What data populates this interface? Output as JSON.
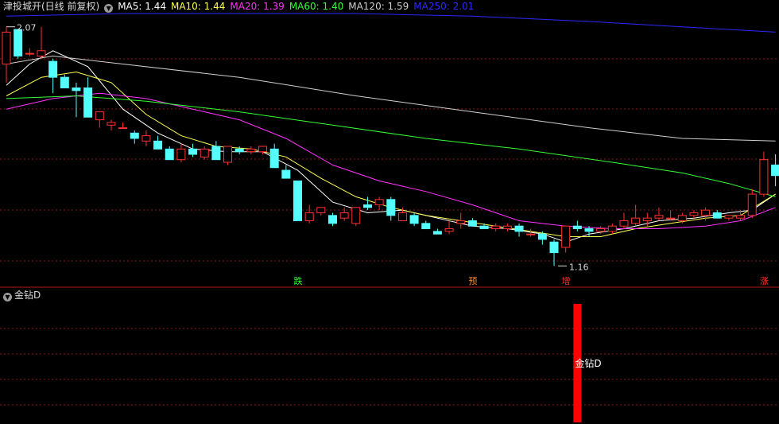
{
  "header": {
    "title": "津投城开(日线 前复权)",
    "ma_items": [
      {
        "label": "MA5: 1.44",
        "color": "#ffffff"
      },
      {
        "label": "MA10: 1.44",
        "color": "#ffff54"
      },
      {
        "label": "MA20: 1.39",
        "color": "#ff33ff"
      },
      {
        "label": "MA60: 1.40",
        "color": "#33ff33"
      },
      {
        "label": "MA120: 1.59",
        "color": "#cfcfcf"
      },
      {
        "label": "MA250: 2.01",
        "color": "#2a2aff"
      }
    ]
  },
  "sub_panel": {
    "title": "金钻D",
    "signal_label": "金钻D"
  },
  "markers": [
    {
      "text": "跌",
      "color": "#33ff33"
    },
    {
      "text": "预",
      "color": "#ff8a1e"
    },
    {
      "text": "增",
      "color": "#ff3030"
    },
    {
      "text": "涨",
      "color": "#ff3030"
    }
  ],
  "chart_data": {
    "type": "candlestick",
    "ylim": [
      1.09,
      2.12
    ],
    "annotations": {
      "high": "2.07",
      "low": "1.16"
    },
    "colors": {
      "up": "#ff3030",
      "down": "#54ffff",
      "grid": "#8a1c1c"
    },
    "candles": [
      [
        1.93,
        2.07,
        1.86,
        2.05
      ],
      [
        2.06,
        2.06,
        1.95,
        1.96
      ],
      [
        1.97,
        1.99,
        1.96,
        1.97
      ],
      [
        1.96,
        2.07,
        1.95,
        1.98
      ],
      [
        1.94,
        1.95,
        1.82,
        1.88
      ],
      [
        1.88,
        1.89,
        1.84,
        1.84
      ],
      [
        1.84,
        1.86,
        1.73,
        1.83
      ],
      [
        1.84,
        1.88,
        1.73,
        1.73
      ],
      [
        1.72,
        1.75,
        1.69,
        1.75
      ],
      [
        1.7,
        1.72,
        1.68,
        1.71
      ],
      [
        1.69,
        1.71,
        1.69,
        1.69
      ],
      [
        1.67,
        1.68,
        1.63,
        1.65
      ],
      [
        1.64,
        1.68,
        1.62,
        1.66
      ],
      [
        1.64,
        1.66,
        1.62,
        1.61
      ],
      [
        1.61,
        1.62,
        1.57,
        1.57
      ],
      [
        1.57,
        1.63,
        1.56,
        1.61
      ],
      [
        1.61,
        1.63,
        1.58,
        1.59
      ],
      [
        1.58,
        1.62,
        1.57,
        1.61
      ],
      [
        1.62,
        1.64,
        1.58,
        1.57
      ],
      [
        1.56,
        1.62,
        1.55,
        1.62
      ],
      [
        1.61,
        1.62,
        1.59,
        1.6
      ],
      [
        1.6,
        1.62,
        1.59,
        1.61
      ],
      [
        1.6,
        1.62,
        1.59,
        1.62
      ],
      [
        1.61,
        1.63,
        1.58,
        1.54
      ],
      [
        1.53,
        1.55,
        1.52,
        1.5
      ],
      [
        1.49,
        1.49,
        1.35,
        1.34
      ],
      [
        1.34,
        1.4,
        1.33,
        1.37
      ],
      [
        1.37,
        1.39,
        1.36,
        1.39
      ],
      [
        1.36,
        1.37,
        1.32,
        1.33
      ],
      [
        1.35,
        1.39,
        1.34,
        1.37
      ],
      [
        1.33,
        1.39,
        1.32,
        1.39
      ],
      [
        1.4,
        1.43,
        1.38,
        1.39
      ],
      [
        1.4,
        1.43,
        1.38,
        1.42
      ],
      [
        1.42,
        1.43,
        1.34,
        1.36
      ],
      [
        1.34,
        1.39,
        1.34,
        1.37
      ],
      [
        1.36,
        1.37,
        1.32,
        1.33
      ],
      [
        1.33,
        1.34,
        1.31,
        1.31
      ],
      [
        1.3,
        1.31,
        1.29,
        1.29
      ],
      [
        1.3,
        1.34,
        1.29,
        1.31
      ],
      [
        1.33,
        1.37,
        1.31,
        1.34
      ],
      [
        1.34,
        1.35,
        1.32,
        1.32
      ],
      [
        1.32,
        1.33,
        1.31,
        1.31
      ],
      [
        1.31,
        1.33,
        1.3,
        1.32
      ],
      [
        1.31,
        1.33,
        1.3,
        1.32
      ],
      [
        1.32,
        1.33,
        1.28,
        1.3
      ],
      [
        1.29,
        1.31,
        1.28,
        1.29
      ],
      [
        1.29,
        1.3,
        1.25,
        1.27
      ],
      [
        1.26,
        1.27,
        1.17,
        1.22
      ],
      [
        1.24,
        1.32,
        1.22,
        1.32
      ],
      [
        1.32,
        1.34,
        1.3,
        1.31
      ],
      [
        1.31,
        1.32,
        1.28,
        1.3
      ],
      [
        1.3,
        1.32,
        1.29,
        1.31
      ],
      [
        1.3,
        1.33,
        1.29,
        1.32
      ],
      [
        1.32,
        1.37,
        1.31,
        1.34
      ],
      [
        1.33,
        1.4,
        1.32,
        1.35
      ],
      [
        1.34,
        1.37,
        1.32,
        1.35
      ],
      [
        1.35,
        1.39,
        1.34,
        1.36
      ],
      [
        1.35,
        1.38,
        1.34,
        1.35
      ],
      [
        1.34,
        1.37,
        1.33,
        1.36
      ],
      [
        1.36,
        1.38,
        1.35,
        1.37
      ],
      [
        1.36,
        1.39,
        1.34,
        1.38
      ],
      [
        1.37,
        1.38,
        1.35,
        1.35
      ],
      [
        1.35,
        1.36,
        1.34,
        1.36
      ],
      [
        1.35,
        1.38,
        1.34,
        1.36
      ],
      [
        1.36,
        1.46,
        1.35,
        1.44
      ],
      [
        1.44,
        1.6,
        1.43,
        1.57
      ],
      [
        1.55,
        1.59,
        1.47,
        1.51
      ]
    ],
    "ma_series": [
      {
        "name": "MA5",
        "color": "#ffffff",
        "points": [
          [
            0,
            1.85
          ],
          [
            2,
            1.93
          ],
          [
            4,
            1.98
          ],
          [
            7,
            1.92
          ],
          [
            10,
            1.76
          ],
          [
            13,
            1.67
          ],
          [
            16,
            1.61
          ],
          [
            19,
            1.6
          ],
          [
            22,
            1.6
          ],
          [
            25,
            1.53
          ],
          [
            28,
            1.41
          ],
          [
            31,
            1.37
          ],
          [
            34,
            1.38
          ],
          [
            37,
            1.35
          ],
          [
            40,
            1.32
          ],
          [
            43,
            1.31
          ],
          [
            46,
            1.29
          ],
          [
            48,
            1.26
          ],
          [
            50,
            1.29
          ],
          [
            53,
            1.31
          ],
          [
            56,
            1.34
          ],
          [
            59,
            1.35
          ],
          [
            62,
            1.37
          ],
          [
            64,
            1.38
          ],
          [
            66,
            1.44
          ]
        ]
      },
      {
        "name": "MA10",
        "color": "#ffff54",
        "points": [
          [
            0,
            1.81
          ],
          [
            3,
            1.88
          ],
          [
            6,
            1.9
          ],
          [
            9,
            1.86
          ],
          [
            12,
            1.74
          ],
          [
            15,
            1.66
          ],
          [
            18,
            1.62
          ],
          [
            21,
            1.61
          ],
          [
            24,
            1.58
          ],
          [
            27,
            1.5
          ],
          [
            30,
            1.43
          ],
          [
            33,
            1.39
          ],
          [
            36,
            1.36
          ],
          [
            39,
            1.34
          ],
          [
            42,
            1.32
          ],
          [
            45,
            1.3
          ],
          [
            48,
            1.28
          ],
          [
            51,
            1.28
          ],
          [
            54,
            1.31
          ],
          [
            57,
            1.33
          ],
          [
            60,
            1.35
          ],
          [
            63,
            1.36
          ],
          [
            66,
            1.44
          ]
        ]
      },
      {
        "name": "MA20",
        "color": "#ff33ff",
        "points": [
          [
            0,
            1.76
          ],
          [
            4,
            1.8
          ],
          [
            8,
            1.82
          ],
          [
            12,
            1.8
          ],
          [
            16,
            1.76
          ],
          [
            20,
            1.72
          ],
          [
            24,
            1.65
          ],
          [
            28,
            1.55
          ],
          [
            32,
            1.49
          ],
          [
            36,
            1.45
          ],
          [
            40,
            1.4
          ],
          [
            44,
            1.34
          ],
          [
            48,
            1.32
          ],
          [
            52,
            1.31
          ],
          [
            56,
            1.31
          ],
          [
            60,
            1.32
          ],
          [
            63,
            1.34
          ],
          [
            66,
            1.39
          ]
        ]
      },
      {
        "name": "MA60",
        "color": "#33ff33",
        "points": [
          [
            0,
            1.8
          ],
          [
            6,
            1.81
          ],
          [
            12,
            1.79
          ],
          [
            20,
            1.75
          ],
          [
            28,
            1.7
          ],
          [
            36,
            1.65
          ],
          [
            44,
            1.61
          ],
          [
            52,
            1.56
          ],
          [
            58,
            1.52
          ],
          [
            62,
            1.48
          ],
          [
            66,
            1.43
          ]
        ]
      },
      {
        "name": "MA120",
        "color": "#cfcfcf",
        "points": [
          [
            0,
            1.93
          ],
          [
            4,
            1.96
          ],
          [
            10,
            1.93
          ],
          [
            20,
            1.88
          ],
          [
            30,
            1.81
          ],
          [
            40,
            1.75
          ],
          [
            50,
            1.69
          ],
          [
            58,
            1.65
          ],
          [
            66,
            1.64
          ]
        ]
      },
      {
        "name": "MA250",
        "color": "#2a2aff",
        "points": [
          [
            0,
            2.11
          ],
          [
            10,
            2.12
          ],
          [
            20,
            2.12
          ],
          [
            30,
            2.12
          ],
          [
            40,
            2.11
          ],
          [
            50,
            2.09
          ],
          [
            58,
            2.07
          ],
          [
            66,
            2.05
          ]
        ]
      }
    ],
    "marker_positions": [
      25,
      40,
      48,
      65
    ],
    "signal": {
      "index": 49,
      "value": 1
    }
  }
}
